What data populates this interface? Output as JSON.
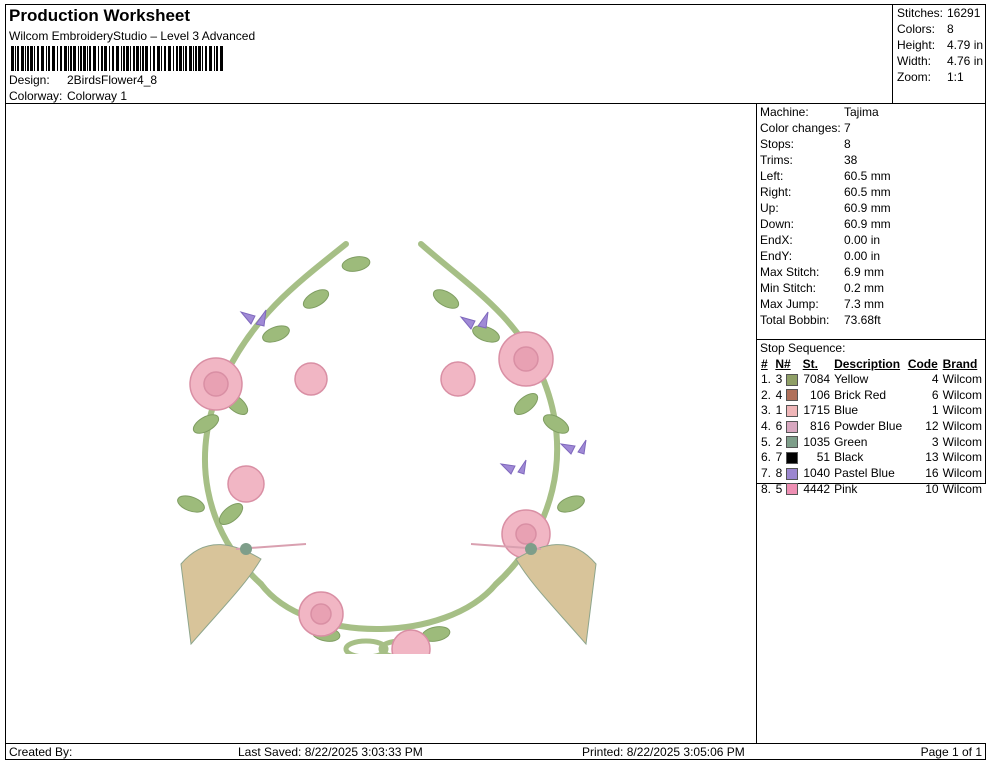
{
  "header": {
    "title": "Production Worksheet",
    "software": "Wilcom EmbroideryStudio – Level 3 Advanced",
    "design_label": "Design:",
    "design_value": "2BirdsFlower4_8",
    "colorway_label": "Colorway:",
    "colorway_value": "Colorway 1"
  },
  "summary": [
    {
      "label": "Stitches:",
      "value": "16291"
    },
    {
      "label": "Colors:",
      "value": "8"
    },
    {
      "label": "Height:",
      "value": "4.79 in"
    },
    {
      "label": "Width:",
      "value": "4.76 in"
    },
    {
      "label": "Zoom:",
      "value": "1:1"
    }
  ],
  "properties": [
    {
      "label": "Machine:",
      "value": "Tajima"
    },
    {
      "label": "Color changes:",
      "value": "7"
    },
    {
      "label": "Stops:",
      "value": "8"
    },
    {
      "label": "Trims:",
      "value": "38"
    },
    {
      "label": "Left:",
      "value": "60.5 mm"
    },
    {
      "label": "Right:",
      "value": "60.5 mm"
    },
    {
      "label": "Up:",
      "value": "60.9 mm"
    },
    {
      "label": "Down:",
      "value": "60.9 mm"
    },
    {
      "label": "EndX:",
      "value": "0.00 in"
    },
    {
      "label": "EndY:",
      "value": "0.00 in"
    },
    {
      "label": "Max Stitch:",
      "value": "6.9 mm"
    },
    {
      "label": "Min Stitch:",
      "value": "0.2 mm"
    },
    {
      "label": "Max Jump:",
      "value": "7.3 mm"
    },
    {
      "label": "Total Bobbin:",
      "value": "73.68ft"
    }
  ],
  "stop_sequence": {
    "title": "Stop Sequence:",
    "columns": [
      "#",
      "N#",
      "St.",
      "Description",
      "Code",
      "Brand"
    ],
    "rows": [
      {
        "idx": "1.",
        "n": "3",
        "st": "7084",
        "desc": "Yellow",
        "code": "4",
        "brand": "Wilcom",
        "color": "#8f9f66"
      },
      {
        "idx": "2.",
        "n": "4",
        "st": "106",
        "desc": "Brick Red",
        "code": "6",
        "brand": "Wilcom",
        "color": "#b0705a"
      },
      {
        "idx": "3.",
        "n": "1",
        "st": "1715",
        "desc": "Blue",
        "code": "1",
        "brand": "Wilcom",
        "color": "#efb6b8"
      },
      {
        "idx": "4.",
        "n": "6",
        "st": "816",
        "desc": "Powder Blue",
        "code": "12",
        "brand": "Wilcom",
        "color": "#d8a8c0"
      },
      {
        "idx": "5.",
        "n": "2",
        "st": "1035",
        "desc": "Green",
        "code": "3",
        "brand": "Wilcom",
        "color": "#7e9e8a"
      },
      {
        "idx": "6.",
        "n": "7",
        "st": "51",
        "desc": "Black",
        "code": "13",
        "brand": "Wilcom",
        "color": "#000000"
      },
      {
        "idx": "7.",
        "n": "8",
        "st": "1040",
        "desc": "Pastel Blue",
        "code": "16",
        "brand": "Wilcom",
        "color": "#9b86cf"
      },
      {
        "idx": "8.",
        "n": "5",
        "st": "4442",
        "desc": "Pink",
        "code": "10",
        "brand": "Wilcom",
        "color": "#ee8fb3"
      }
    ]
  },
  "footer": {
    "created_by": "Created By:",
    "last_saved": "Last Saved: 8/22/2025 3:03:33 PM",
    "printed": "Printed: 8/22/2025 3:05:06 PM",
    "page": "Page 1 of 1"
  }
}
